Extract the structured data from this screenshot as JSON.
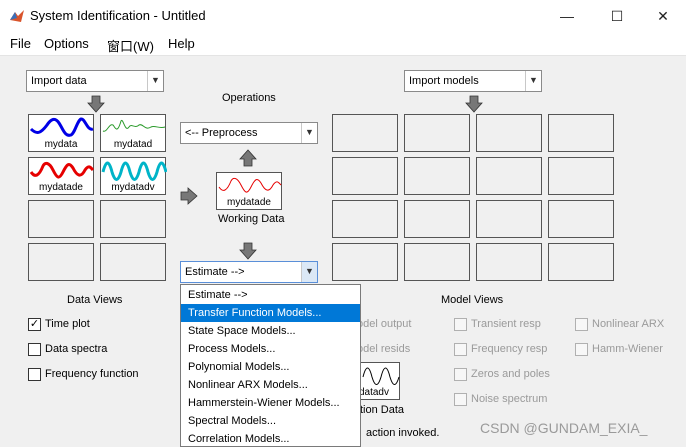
{
  "window": {
    "title": "System Identification - Untitled",
    "controls": {
      "minimize": "—",
      "maximize": "☐",
      "close": "✕"
    }
  },
  "menu": [
    "File",
    "Options",
    "窗口(W)",
    "Help"
  ],
  "left": {
    "import_data_label": "Import data",
    "data_tiles": [
      "mydata",
      "mydatad",
      "mydatade",
      "mydatadv"
    ],
    "data_views_label": "Data Views",
    "checkboxes": [
      {
        "label": "Time plot",
        "checked": true
      },
      {
        "label": "Data spectra",
        "checked": false
      },
      {
        "label": "Frequency function",
        "checked": false
      }
    ]
  },
  "center": {
    "operations_label": "Operations",
    "preprocess_label": "<-- Preprocess",
    "working_data_tile": "mydatade",
    "working_data_label": "Working Data",
    "estimate_label": "Estimate -->",
    "estimate_options": [
      "Estimate -->",
      "Transfer Function Models...",
      "State Space Models...",
      "Process Models...",
      "Polynomial Models...",
      "Nonlinear ARX Models...",
      "Hammerstein-Wiener Models...",
      "Spectral Models...",
      "Correlation Models..."
    ],
    "estimate_selected_index": 1
  },
  "right": {
    "import_models_label": "Import models",
    "model_views_label": "Model Views",
    "model_views": [
      {
        "label": "Model output",
        "visible": "odel output"
      },
      {
        "label": "Model resids",
        "visible": "odel resids"
      },
      {
        "label": "Transient resp"
      },
      {
        "label": "Frequency resp"
      },
      {
        "label": "Zeros and poles"
      },
      {
        "label": "Noise spectrum"
      },
      {
        "label": "Nonlinear ARX"
      },
      {
        "label": "Hamm-Wiener"
      }
    ],
    "validation_tile": "datadv",
    "validation_label_visible": "tion Data",
    "status_visible": "action invoked."
  },
  "watermark": "CSDN @GUNDAM_EXIA_",
  "colors": {
    "mydata": "#0000e6",
    "mydatad": "#2a9a2a",
    "mydatade": "#e60000",
    "mydatadv": "#00b4c8",
    "selection": "#0078d7"
  }
}
